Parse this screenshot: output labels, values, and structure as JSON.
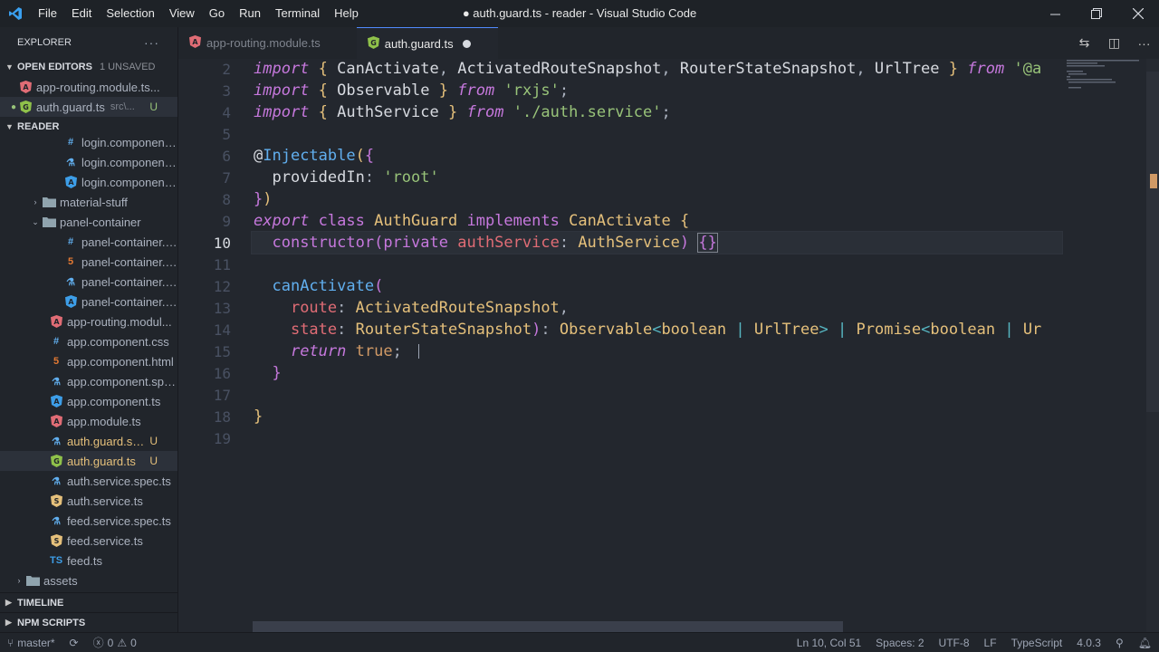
{
  "titlebar": {
    "menu": [
      "File",
      "Edit",
      "Selection",
      "View",
      "Go",
      "Run",
      "Terminal",
      "Help"
    ],
    "title": "● auth.guard.ts - reader - Visual Studio Code"
  },
  "sidebar": {
    "header": "EXPLORER",
    "open_editors": {
      "label": "OPEN EDITORS",
      "unsaved": "1 UNSAVED"
    },
    "open_files": [
      {
        "name": "app-routing.module.ts...",
        "icon": "angular-icon",
        "hint": "",
        "badge": ""
      },
      {
        "name": "auth.guard.ts",
        "icon": "guard-icon",
        "hint": "src\\...",
        "badge": "U"
      }
    ],
    "reader_label": "READER",
    "tree": [
      {
        "name": "login.component....",
        "icon": "css-icon",
        "indent": 2,
        "badge": ""
      },
      {
        "name": "login.component.s...",
        "icon": "test-icon",
        "indent": 2,
        "badge": ""
      },
      {
        "name": "login.component.ts",
        "icon": "angular-ts-icon",
        "indent": 2,
        "badge": ""
      },
      {
        "name": "material-stuff",
        "icon": "folder-icon",
        "indent": 1,
        "badge": "",
        "folder": "closed"
      },
      {
        "name": "panel-container",
        "icon": "folder-icon",
        "indent": 1,
        "badge": "",
        "folder": "open"
      },
      {
        "name": "panel-container.co...",
        "icon": "css-icon",
        "indent": 2,
        "badge": ""
      },
      {
        "name": "panel-container.co...",
        "icon": "html-icon",
        "indent": 2,
        "badge": ""
      },
      {
        "name": "panel-container.co...",
        "icon": "test-icon",
        "indent": 2,
        "badge": ""
      },
      {
        "name": "panel-container.co...",
        "icon": "angular-ts-icon",
        "indent": 2,
        "badge": ""
      },
      {
        "name": "app-routing.modul...",
        "icon": "angular-icon",
        "indent": 1,
        "badge": ""
      },
      {
        "name": "app.component.css",
        "icon": "css-icon",
        "indent": 1,
        "badge": ""
      },
      {
        "name": "app.component.html",
        "icon": "html-icon",
        "indent": 1,
        "badge": ""
      },
      {
        "name": "app.component.spe...",
        "icon": "test-icon",
        "indent": 1,
        "badge": ""
      },
      {
        "name": "app.component.ts",
        "icon": "angular-ts-icon",
        "indent": 1,
        "badge": ""
      },
      {
        "name": "app.module.ts",
        "icon": "angular-icon",
        "indent": 1,
        "badge": ""
      },
      {
        "name": "auth.guard.spe...",
        "icon": "test-icon",
        "indent": 1,
        "badge": "U",
        "git": true
      },
      {
        "name": "auth.guard.ts",
        "icon": "guard-icon",
        "indent": 1,
        "badge": "U",
        "git": true,
        "selected": true
      },
      {
        "name": "auth.service.spec.ts",
        "icon": "test-icon",
        "indent": 1,
        "badge": ""
      },
      {
        "name": "auth.service.ts",
        "icon": "service-icon",
        "indent": 1,
        "badge": ""
      },
      {
        "name": "feed.service.spec.ts",
        "icon": "test-icon",
        "indent": 1,
        "badge": ""
      },
      {
        "name": "feed.service.ts",
        "icon": "service-icon",
        "indent": 1,
        "badge": ""
      },
      {
        "name": "feed.ts",
        "icon": "ts-icon",
        "indent": 1,
        "badge": ""
      },
      {
        "name": "assets",
        "icon": "folder-icon",
        "indent": 0,
        "badge": "",
        "folder": "closed"
      }
    ],
    "timeline": "TIMELINE",
    "npm": "NPM SCRIPTS"
  },
  "tabs": [
    {
      "name": "app-routing.module.ts",
      "icon": "angular-icon",
      "active": false
    },
    {
      "name": "auth.guard.ts",
      "icon": "guard-icon",
      "active": true,
      "dirty": true
    }
  ],
  "editor": {
    "line_numbers": [
      "2",
      "3",
      "4",
      "5",
      "6",
      "7",
      "8",
      "9",
      "10",
      "11",
      "12",
      "13",
      "14",
      "15",
      "16",
      "17",
      "18",
      "19"
    ],
    "current_line": "10"
  },
  "status": {
    "branch": "master*",
    "errors": "0",
    "warnings": "0",
    "position": "Ln 10, Col 51",
    "spaces": "Spaces: 2",
    "encoding": "UTF-8",
    "eol": "LF",
    "language": "TypeScript",
    "version": "4.0.3"
  }
}
